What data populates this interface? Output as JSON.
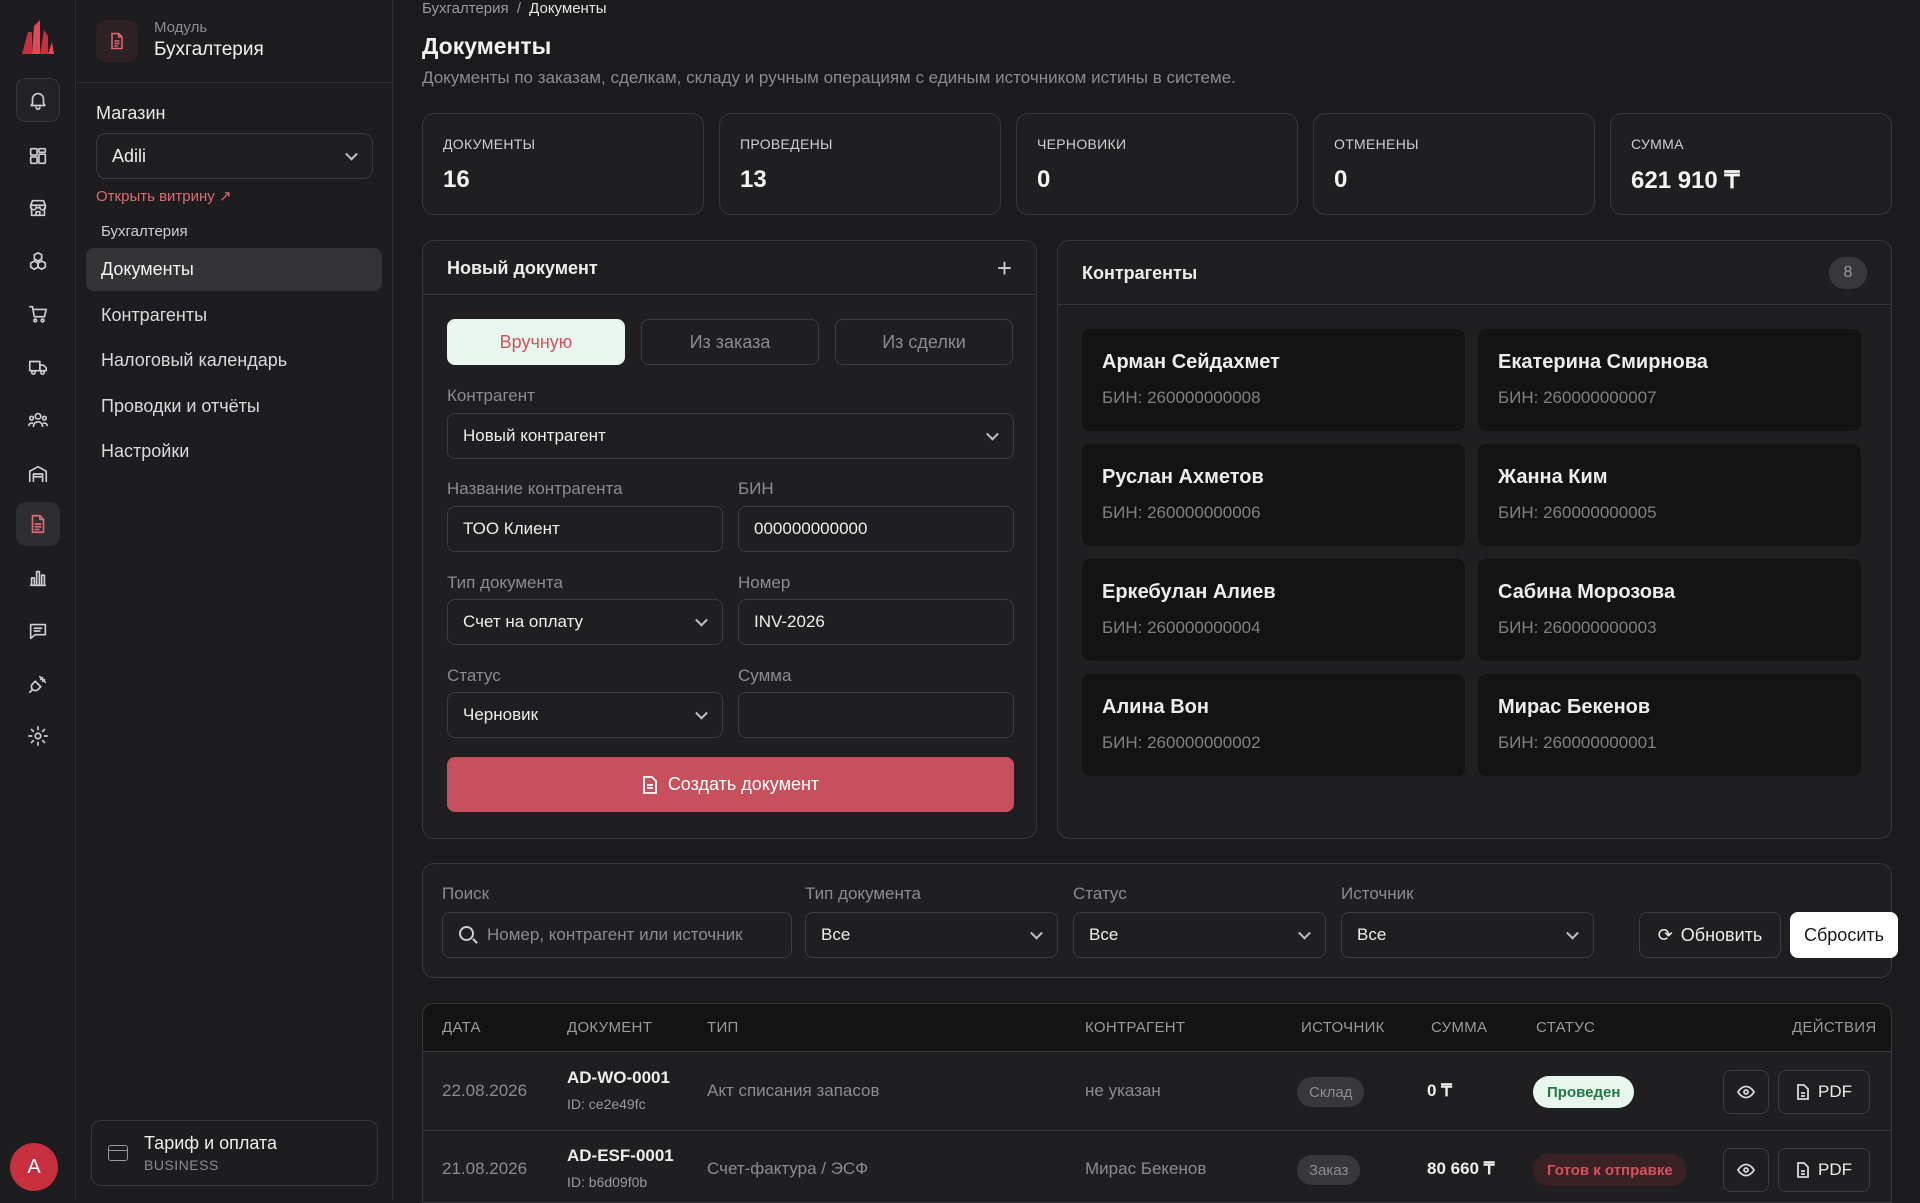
{
  "user": {
    "avatar_initial": "A"
  },
  "rail": {
    "items": [
      {
        "icon": "bell-icon"
      },
      {
        "icon": "dashboard-icon"
      },
      {
        "icon": "store-icon"
      },
      {
        "icon": "products-icon"
      },
      {
        "icon": "cart-icon"
      },
      {
        "icon": "truck-icon"
      },
      {
        "icon": "users-icon"
      },
      {
        "icon": "warehouse-icon"
      },
      {
        "icon": "document-icon"
      },
      {
        "icon": "bar-chart-icon"
      },
      {
        "icon": "chat-icon"
      },
      {
        "icon": "plug-icon"
      },
      {
        "icon": "gear-icon"
      }
    ],
    "active_index": 8
  },
  "sidebar": {
    "module_caption": "Модуль",
    "module_title": "Бухгалтерия",
    "store_label": "Магазин",
    "store_value": "Adili",
    "storefront_link": "Открыть витрину ↗",
    "section_caption": "Бухгалтерия",
    "items": [
      {
        "label": "Документы"
      },
      {
        "label": "Контрагенты"
      },
      {
        "label": "Налоговый календарь"
      },
      {
        "label": "Проводки и отчёты"
      },
      {
        "label": "Настройки"
      }
    ],
    "plan_title": "Тариф и оплата",
    "plan_sub": "BUSINESS"
  },
  "header": {
    "breadcrumb_parent": "Бухгалтерия",
    "breadcrumb_sep": "/",
    "breadcrumb_current": "Документы",
    "title": "Документы",
    "subtitle": "Документы по заказам, сделкам, складу и ручным операциям с единым источником истины в системе."
  },
  "stats": [
    {
      "label": "ДОКУМЕНТЫ",
      "value": "16"
    },
    {
      "label": "ПРОВЕДЕНЫ",
      "value": "13"
    },
    {
      "label": "ЧЕРНОВИКИ",
      "value": "0"
    },
    {
      "label": "ОТМЕНЕНЫ",
      "value": "0"
    },
    {
      "label": "СУММА",
      "value": "621 910 ₸"
    }
  ],
  "new_doc": {
    "title": "Новый документ",
    "modes": [
      "Вручную",
      "Из заказа",
      "Из сделки"
    ],
    "counterparty_label": "Контрагент",
    "counterparty_value": "Новый контрагент",
    "name_label": "Название контрагента",
    "name_value": "ТОО Клиент",
    "bin_label": "БИН",
    "bin_value": "000000000000",
    "type_label": "Тип документа",
    "type_value": "Счет на оплату",
    "number_label": "Номер",
    "number_value": "INV-2026",
    "status_label": "Статус",
    "status_value": "Черновик",
    "sum_label": "Сумма",
    "sum_value": "",
    "create_label": "Создать документ"
  },
  "counterparties": {
    "title": "Контрагенты",
    "count": "8",
    "items": [
      {
        "name": "Арман Сейдахмет",
        "bin": "БИН: 260000000008"
      },
      {
        "name": "Екатерина Смирнова",
        "bin": "БИН: 260000000007"
      },
      {
        "name": "Руслан Ахметов",
        "bin": "БИН: 260000000006"
      },
      {
        "name": "Жанна Ким",
        "bin": "БИН: 260000000005"
      },
      {
        "name": "Еркебулан Алиев",
        "bin": "БИН: 260000000004"
      },
      {
        "name": "Сабина Морозова",
        "bin": "БИН: 260000000003"
      },
      {
        "name": "Алина Вон",
        "bin": "БИН: 260000000002"
      },
      {
        "name": "Мирас Бекенов",
        "bin": "БИН: 260000000001"
      }
    ]
  },
  "filters": {
    "search_label": "Поиск",
    "search_placeholder": "Номер, контрагент или источник",
    "type_label": "Тип документа",
    "type_value": "Все",
    "status_label": "Статус",
    "status_value": "Все",
    "source_label": "Источник",
    "source_value": "Все",
    "refresh_label": "Обновить",
    "reset_label": "Сбросить"
  },
  "table": {
    "columns": [
      "ДАТА",
      "ДОКУМЕНТ",
      "ТИП",
      "КОНТРАГЕНТ",
      "ИСТОЧНИК",
      "СУММА",
      "СТАТУС",
      "ДЕЙСТВИЯ"
    ],
    "rows": [
      {
        "date": "22.08.2026",
        "number": "AD-WO-0001",
        "id": "ID: ce2e49fc",
        "type": "Акт списания запасов",
        "counterparty": "не указан",
        "source": "Склад",
        "sum": "0 ₸",
        "status": "Проведен",
        "pdf": "PDF"
      },
      {
        "date": "21.08.2026",
        "number": "AD-ESF-0001",
        "id": "ID: b6d09f0b",
        "type": "Счет-фактура / ЭСФ",
        "counterparty": "Мирас Бекенов",
        "source": "Заказ",
        "sum": "80 660 ₸",
        "status": "Готов к отправке",
        "pdf": "PDF"
      }
    ]
  },
  "colors": {
    "accent": "#c7505c",
    "success_bg": "#e8f6ee",
    "success_fg": "#1f7a45",
    "bg": "#1b1b1d"
  }
}
